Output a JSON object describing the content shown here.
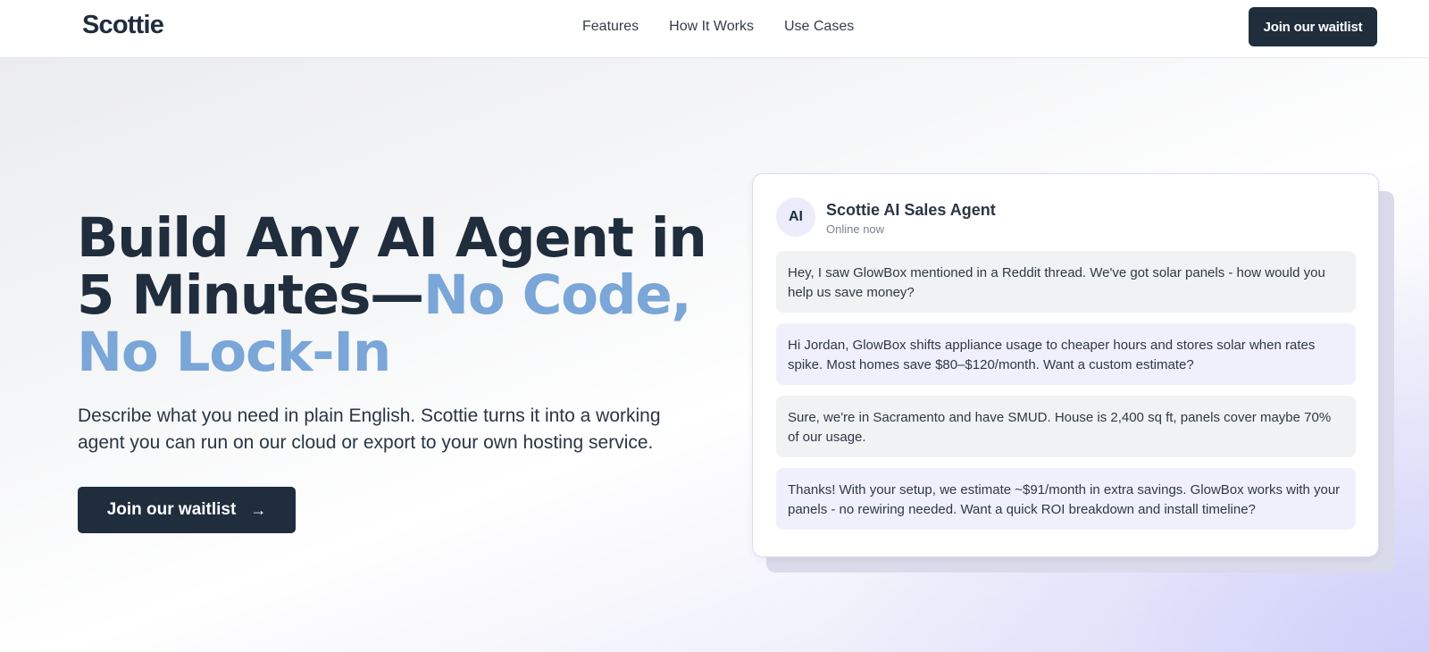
{
  "header": {
    "logo": "Scottie",
    "nav": [
      "Features",
      "How It Works",
      "Use Cases"
    ],
    "cta_label": "Join our waitlist"
  },
  "hero": {
    "headline_main": "Build Any AI Agent in 5 Minutes—",
    "headline_accent": "No Code, No Lock-In",
    "subhead": "Describe what you need in plain English. Scottie turns it into a working agent you can run on our cloud or export to your own hosting service.",
    "cta_label": "Join our waitlist",
    "cta_icon": "arrow-right-icon"
  },
  "chat": {
    "avatar_text": "AI",
    "agent_name": "Scottie AI Sales Agent",
    "status": "Online now",
    "messages": [
      {
        "from": "user",
        "text": "Hey, I saw GlowBox mentioned in a Reddit thread. We've got solar panels - how would you help us save money?"
      },
      {
        "from": "agent",
        "text": "Hi Jordan, GlowBox shifts appliance usage to cheaper hours and stores solar when rates spike. Most homes save $80–$120/month. Want a custom estimate?"
      },
      {
        "from": "user",
        "text": "Sure, we're in Sacramento and have SMUD. House is 2,400 sq ft, panels cover maybe 70% of our usage."
      },
      {
        "from": "agent",
        "text": "Thanks! With your setup, we estimate ~$91/month in extra savings. GlowBox works with your panels - no rewiring needed. Want a quick ROI breakdown and install timeline?"
      }
    ]
  },
  "colors": {
    "primary_dark": "#1f2d3d",
    "accent_blue": "#7aa6d8",
    "agent_bubble": "#f0f0fc",
    "user_bubble": "#f1f2f4"
  }
}
